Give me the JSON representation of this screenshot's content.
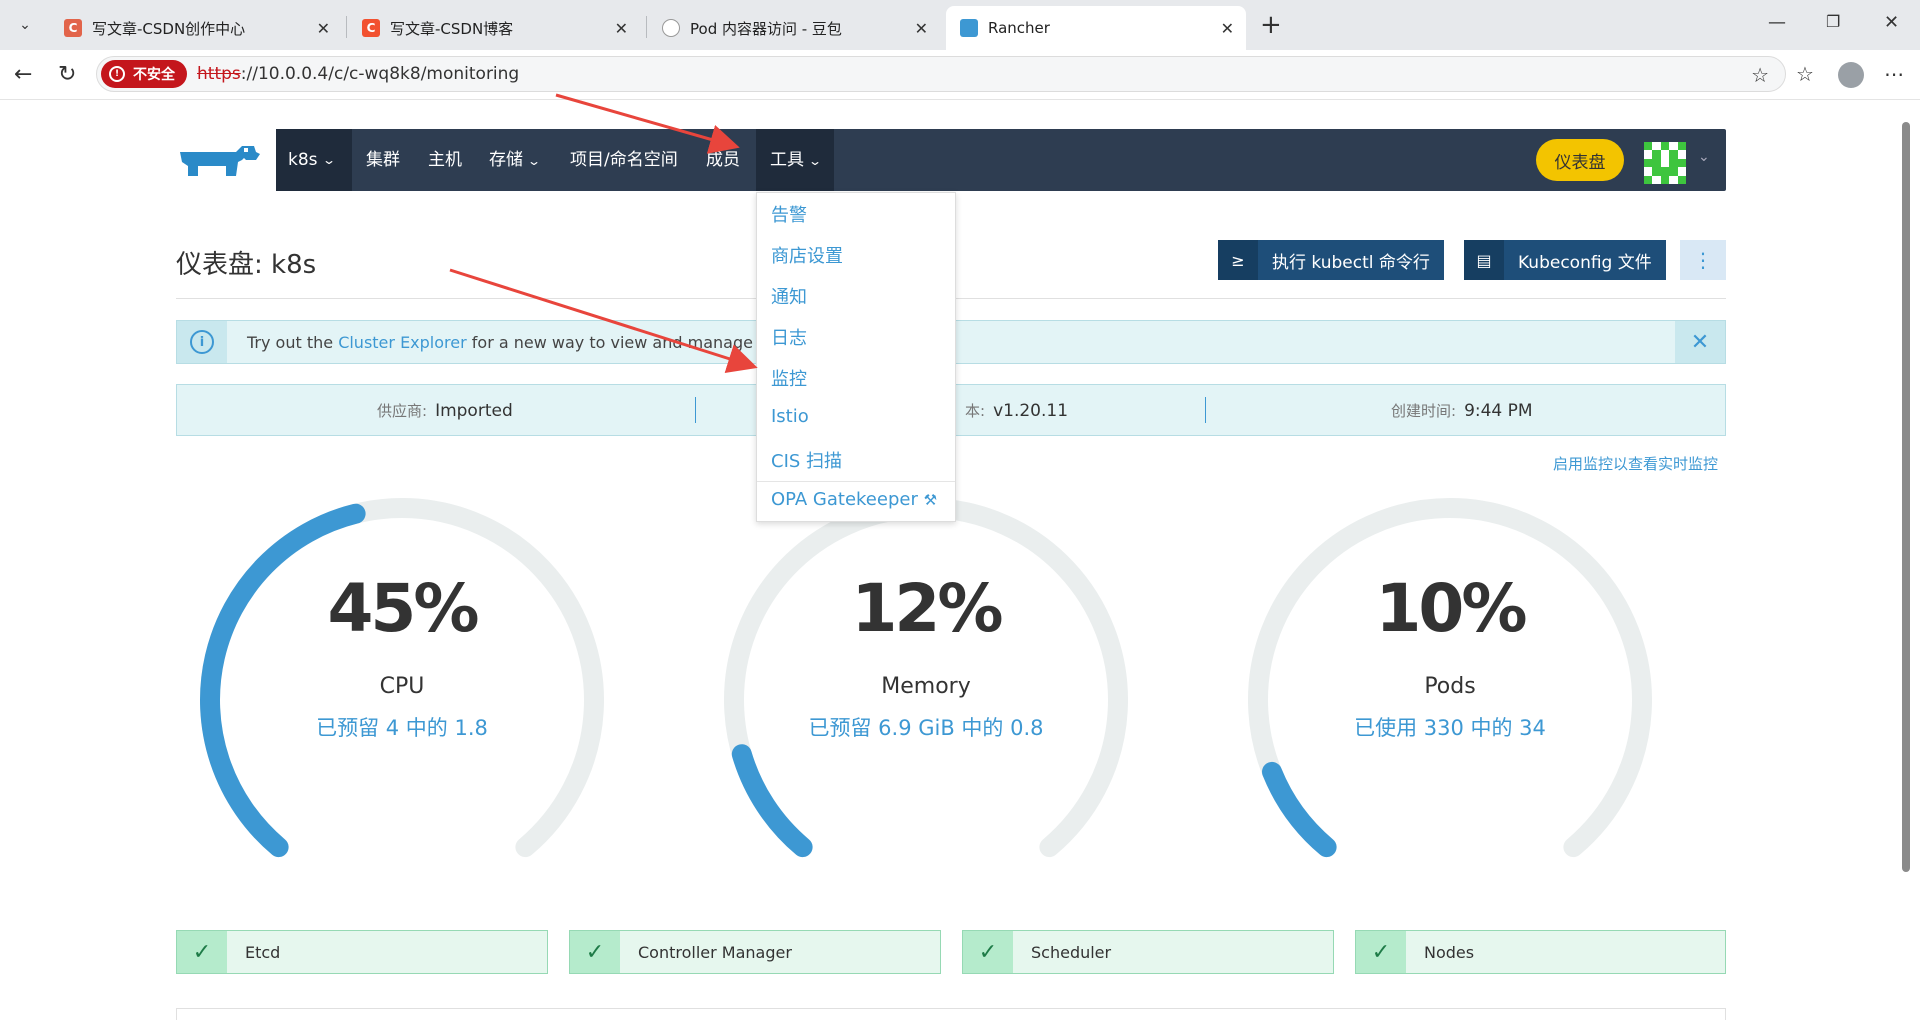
{
  "browser": {
    "tabs": [
      {
        "title": "写文章-CSDN创作中心",
        "fav": "C",
        "fav_color": "#e2644a"
      },
      {
        "title": "写文章-CSDN博客",
        "fav": "C",
        "fav_color": "#f25130"
      },
      {
        "title": "Pod 内容器访问 - 豆包",
        "fav": "",
        "fav_color": "#ffffff"
      },
      {
        "title": "Rancher",
        "fav": "",
        "fav_color": "#3d98d3"
      }
    ],
    "insecure_label": "不安全",
    "url_scheme": "https",
    "url_rest": "://10.0.0.4/c/c-wq8k8/monitoring"
  },
  "nav": {
    "cluster": "k8s",
    "items": [
      "集群",
      "主机",
      "存储",
      "项目/命名空间",
      "成员",
      "工具"
    ],
    "dashboard_button": "仪表盘"
  },
  "tools_menu": {
    "items": [
      "告警",
      "商店设置",
      "通知",
      "日志",
      "监控",
      "Istio",
      "CIS 扫描"
    ],
    "footer_item": "OPA Gatekeeper"
  },
  "header": {
    "title": "仪表盘: k8s",
    "kubectl_button": "执行 kubectl 命令行",
    "kubeconfig_button": "Kubeconfig 文件"
  },
  "banner": {
    "prefix": "Try out the ",
    "link": "Cluster Explorer",
    "suffix": " for a new way to view and manage y"
  },
  "info": {
    "provider_key": "供应商:",
    "provider_val": "Imported",
    "version_key": "本:",
    "version_val": "v1.20.11",
    "created_key": "创建时间:",
    "created_val": "9:44 PM"
  },
  "enable_monitoring_link": "启用监控以查看实时监控",
  "gauges": [
    {
      "percent": "45%",
      "name": "CPU",
      "detail": "已预留 4 中的 1.8",
      "value": 0.45
    },
    {
      "percent": "12%",
      "name": "Memory",
      "detail": "已预留 6.9 GiB 中的 0.8",
      "value": 0.12
    },
    {
      "percent": "10%",
      "name": "Pods",
      "detail": "已使用 330 中的 34",
      "value": 0.1
    }
  ],
  "components": [
    "Etcd",
    "Controller Manager",
    "Scheduler",
    "Nodes"
  ],
  "colors": {
    "accent": "#3d98d3",
    "nav": "#2e3d51",
    "arrow": "#e8453c",
    "ok": "#1e7b47"
  }
}
